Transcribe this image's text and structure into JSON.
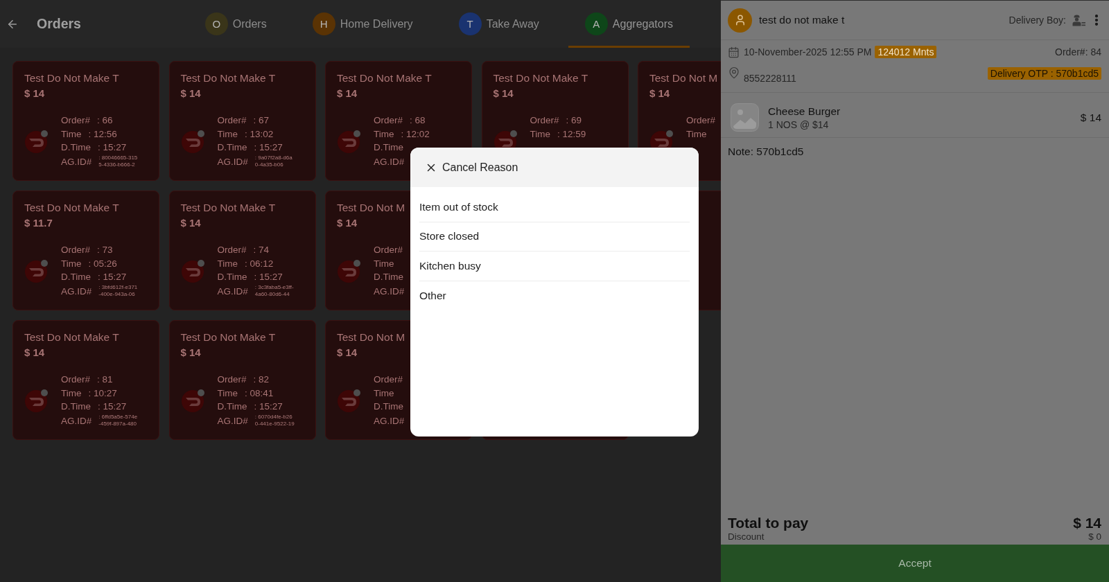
{
  "header": {
    "title": "Orders"
  },
  "tabs": [
    {
      "letter": "O",
      "label": "Orders",
      "color": "#3a3519",
      "selected": false
    },
    {
      "letter": "H",
      "label": "Home Delivery",
      "color": "#5a3304",
      "selected": false
    },
    {
      "letter": "T",
      "label": "Take Away",
      "color": "#1a3370",
      "selected": false
    },
    {
      "letter": "A",
      "label": "Aggregators",
      "color": "#0e4619",
      "selected": true
    }
  ],
  "orders": [
    {
      "kind": "order",
      "title": "Test Do Not Make T",
      "price": "$ 14",
      "order_no": {
        "label": "Order#",
        "value": ": 66"
      },
      "time": {
        "label": "Time",
        "value": ": 12:56"
      },
      "d_time": {
        "label": "D.Time",
        "value": ": 15:27"
      },
      "ag_id": {
        "label": "AG.ID#",
        "value": ": 80046665-3155-4336-b666-2"
      }
    },
    {
      "kind": "order",
      "title": "Test Do Not Make T",
      "price": "$ 14",
      "order_no": {
        "label": "Order#",
        "value": ": 67"
      },
      "time": {
        "label": "Time",
        "value": ": 13:02"
      },
      "d_time": {
        "label": "D.Time",
        "value": ": 15:27"
      },
      "ag_id": {
        "label": "AG.ID#",
        "value": ": 9a07f2a8-d6a0-4a35-b06"
      }
    },
    {
      "kind": "order",
      "title": "Test Do Not Make T",
      "price": "$ 14",
      "order_no": {
        "label": "Order#",
        "value": ": 68"
      },
      "time": {
        "label": "Time",
        "value": ": 12:02"
      },
      "d_time": {
        "label": "D.Time"
      },
      "ag_id": {
        "label": "AG.ID#"
      }
    },
    {
      "kind": "order",
      "title": "Test Do Not Make T",
      "price": "$ 14",
      "order_no": {
        "label": "Order#",
        "value": ": 69"
      },
      "time": {
        "label": "Time",
        "value": ": 12:59"
      }
    },
    {
      "kind": "order",
      "title": "Test Do Not M",
      "price": "$ 14",
      "order_no": {
        "label": "Order#"
      },
      "time": {
        "label": "Time"
      }
    },
    {
      "kind": "order",
      "title": "Test Do Not Make T",
      "price": "$ 11.7",
      "order_no": {
        "label": "Order#",
        "value": ": 73"
      },
      "time": {
        "label": "Time",
        "value": ": 05:26"
      },
      "d_time": {
        "label": "D.Time",
        "value": ": 15:27"
      },
      "ag_id": {
        "label": "AG.ID#",
        "value": ": 3bfd612f-e371-400e-943a-06"
      }
    },
    {
      "kind": "order",
      "title": "Test Do Not Make T",
      "price": "$ 14",
      "order_no": {
        "label": "Order#",
        "value": ": 74"
      },
      "time": {
        "label": "Time",
        "value": ": 06:12"
      },
      "d_time": {
        "label": "D.Time",
        "value": ": 15:27"
      },
      "ag_id": {
        "label": "AG.ID#",
        "value": ": 3c3faba5-e3ff-4a60-80d6-44"
      }
    },
    {
      "kind": "order",
      "title": "Test Do Not M",
      "price": "$ 14",
      "order_no": {
        "label": "Order#"
      },
      "time": {
        "label": "Time"
      },
      "d_time": {
        "label": "D.Time"
      },
      "ag_id": {
        "label": "AG.ID#"
      }
    },
    {
      "kind": "hidden"
    },
    {
      "kind": "blank"
    },
    {
      "kind": "order",
      "title": "Test Do Not Make T",
      "price": "$ 14",
      "order_no": {
        "label": "Order#",
        "value": ": 81"
      },
      "time": {
        "label": "Time",
        "value": ": 10:27"
      },
      "d_time": {
        "label": "D.Time",
        "value": ": 15:27"
      },
      "ag_id": {
        "label": "AG.ID#",
        "value": ": 6ffd5a5e-574e-459f-897a-480"
      }
    },
    {
      "kind": "order",
      "title": "Test Do Not Make T",
      "price": "$ 14",
      "order_no": {
        "label": "Order#",
        "value": ": 82"
      },
      "time": {
        "label": "Time",
        "value": ": 08:41"
      },
      "d_time": {
        "label": "D.Time",
        "value": ": 15:27"
      },
      "ag_id": {
        "label": "AG.ID#",
        "value": ": 6070d4fe-b260-441e-9522-19"
      }
    },
    {
      "kind": "order",
      "title": "Test Do Not M",
      "price": "$ 14",
      "order_no": {
        "label": "Order#"
      },
      "time": {
        "label": "Time"
      },
      "d_time": {
        "label": "D.Time"
      },
      "ag_id": {
        "label": "AG.ID#"
      }
    },
    {
      "kind": "blank"
    }
  ],
  "detail": {
    "customer": "test do not make t",
    "delivery_boy_label": "Delivery Boy:",
    "date": "10-November-2025 12:55 PM",
    "elapsed": "124012 Mnts",
    "order_no": "Order#: 84",
    "phone": "8552228111",
    "otp": "Delivery OTP : 570b1cd5",
    "items": [
      {
        "name": "Cheese Burger",
        "qty": "1 NOS @ $14",
        "price": "$ 14"
      }
    ],
    "note": "Note: 570b1cd5",
    "total_label": "Total to pay",
    "total": "$ 14",
    "discount_label": "Discount",
    "discount": "$ 0",
    "accept": "Accept"
  },
  "cancel_dialog": {
    "title": "Cancel Reason",
    "reasons": [
      {
        "label": "Item out of stock",
        "selected": false
      },
      {
        "label": "Store closed",
        "selected": false
      },
      {
        "label": "Kitchen busy",
        "selected": false
      },
      {
        "label": "Other",
        "selected": false
      }
    ]
  }
}
